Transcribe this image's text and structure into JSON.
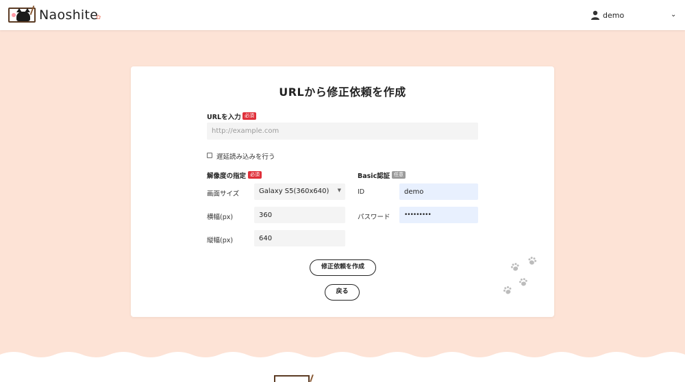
{
  "header": {
    "brand": "Naoshite",
    "user": "demo",
    "caret": "⌄"
  },
  "form": {
    "title": "URLから修正依頼を作成",
    "url": {
      "label": "URLを入力",
      "badge": "必須",
      "placeholder": "http://example.com",
      "value": ""
    },
    "lazy_load": {
      "label": "遅延読み込みを行う",
      "checked": false
    },
    "resolution": {
      "label": "解像度の指定",
      "badge": "必須",
      "screen_size_label": "画面サイズ",
      "screen_size_value": "Galaxy S5(360x640)",
      "width_label": "横幅(px)",
      "width_value": "360",
      "height_label": "縦幅(px)",
      "height_value": "640"
    },
    "basic_auth": {
      "label": "Basic認証",
      "badge": "任意",
      "id_label": "ID",
      "id_value": "demo",
      "password_label": "パスワード",
      "password_value": "•••••••••"
    },
    "submit_label": "修正依頼を作成",
    "back_label": "戻る"
  },
  "colors": {
    "background": "#fde3d6",
    "required_badge": "#e0303a",
    "optional_badge": "#9a9a9a",
    "autofill_blue": "#e8f0fe"
  }
}
